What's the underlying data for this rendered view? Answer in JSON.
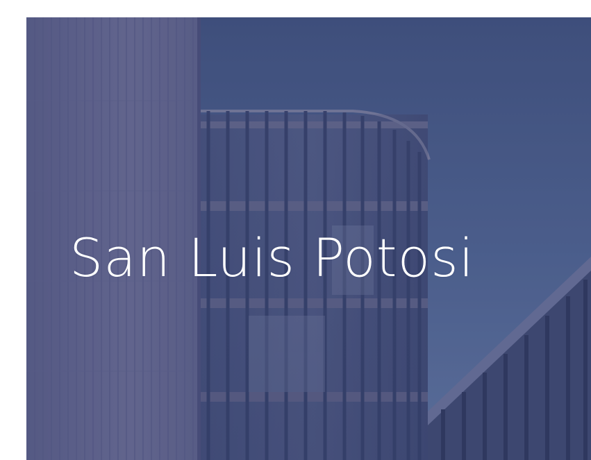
{
  "hero": {
    "title": "San Luis Potosi",
    "image_subject": "architecture-photo",
    "overlay_color": "#3f4d7c",
    "title_color": "#ffffff"
  }
}
